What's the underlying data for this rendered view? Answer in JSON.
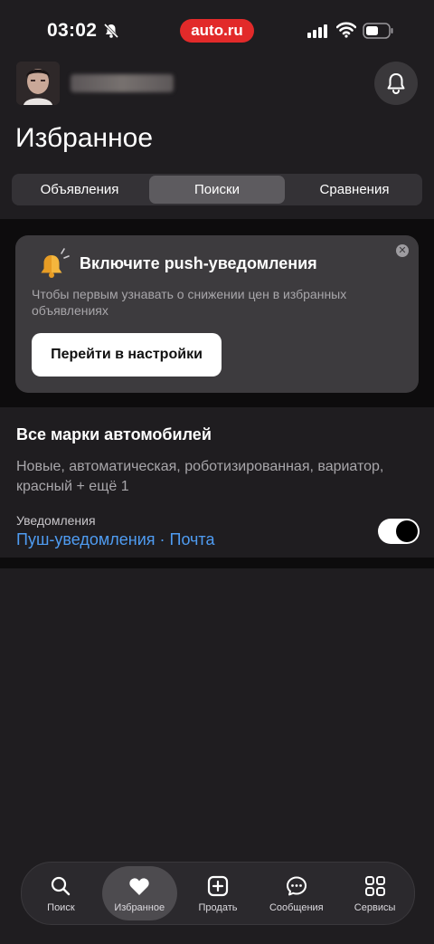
{
  "status_bar": {
    "time": "03:02",
    "brand": "auto.ru"
  },
  "page": {
    "title": "Избранное"
  },
  "segments": [
    {
      "label": "Объявления",
      "active": false
    },
    {
      "label": "Поиски",
      "active": true
    },
    {
      "label": "Сравнения",
      "active": false
    }
  ],
  "push_promo": {
    "title": "Включите push-уведомления",
    "description": "Чтобы первым узнавать о снижении цен в избранных объявлениях",
    "button_label": "Перейти в настройки",
    "close_icon": "close-icon"
  },
  "saved_search": {
    "title": "Все марки автомобилей",
    "params": "Новые, автоматическая, роботизированная, вариатор, красный + ещё 1",
    "notifications_label": "Уведомления",
    "channel_push": "Пуш-уведомления",
    "separator": " · ",
    "channel_email": "Почта",
    "toggle_on": true
  },
  "tabbar": {
    "items": [
      {
        "label": "Поиск",
        "icon": "search-icon"
      },
      {
        "label": "Избранное",
        "icon": "heart-icon",
        "active": true
      },
      {
        "label": "Продать",
        "icon": "plus-square-icon"
      },
      {
        "label": "Сообщения",
        "icon": "chat-bubble-icon"
      },
      {
        "label": "Сервисы",
        "icon": "grid-icon"
      }
    ]
  },
  "colors": {
    "background": "#1f1d20",
    "card": "#3d3b3e",
    "link": "#4f9cf2",
    "brand": "#e22a2a"
  }
}
